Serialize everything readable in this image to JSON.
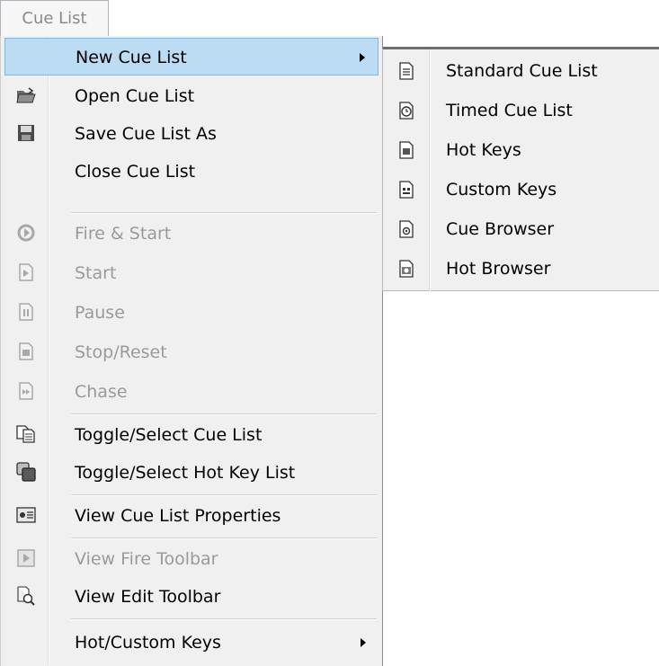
{
  "menubar": {
    "title": "Cue List"
  },
  "menu": {
    "items": [
      {
        "label": "New Cue List",
        "icon": "none",
        "disabled": false,
        "submenu": true,
        "highlight": true
      },
      {
        "label": "Open Cue List",
        "icon": "open-folder-icon",
        "disabled": false
      },
      {
        "label": "Save Cue List As",
        "icon": "save-disk-icon",
        "disabled": false
      },
      {
        "label": "Close Cue List",
        "icon": "none",
        "disabled": false
      },
      {
        "label": "Fire & Start",
        "icon": "fire-start-icon",
        "disabled": true
      },
      {
        "label": "Start",
        "icon": "start-icon",
        "disabled": true
      },
      {
        "label": "Pause",
        "icon": "pause-icon",
        "disabled": true
      },
      {
        "label": "Stop/Reset",
        "icon": "stop-reset-icon",
        "disabled": true
      },
      {
        "label": "Chase",
        "icon": "chase-icon",
        "disabled": true
      },
      {
        "label": "Toggle/Select Cue List",
        "icon": "toggle-cue-list-icon",
        "disabled": false
      },
      {
        "label": "Toggle/Select Hot Key List",
        "icon": "toggle-hot-key-list-icon",
        "disabled": false
      },
      {
        "label": "View Cue List Properties",
        "icon": "properties-icon",
        "disabled": false
      },
      {
        "label": "View Fire Toolbar",
        "icon": "fire-toolbar-icon",
        "disabled": true
      },
      {
        "label": "View Edit Toolbar",
        "icon": "edit-toolbar-icon",
        "disabled": false
      },
      {
        "label": "Hot/Custom Keys",
        "icon": "none",
        "disabled": false,
        "submenu": true
      }
    ]
  },
  "submenu": {
    "items": [
      {
        "label": "Standard Cue List",
        "icon": "standard-cue-list-icon"
      },
      {
        "label": "Timed Cue List",
        "icon": "timed-cue-list-icon"
      },
      {
        "label": "Hot Keys",
        "icon": "hot-keys-icon"
      },
      {
        "label": "Custom Keys",
        "icon": "custom-keys-icon"
      },
      {
        "label": "Cue Browser",
        "icon": "cue-browser-icon"
      },
      {
        "label": "Hot Browser",
        "icon": "hot-browser-icon"
      }
    ]
  },
  "colors": {
    "highlight": "#bcdcf4",
    "highlight_border": "#7ab7e6",
    "disabled_text": "#9a9a9a",
    "menu_bg": "#f0f0f0"
  }
}
